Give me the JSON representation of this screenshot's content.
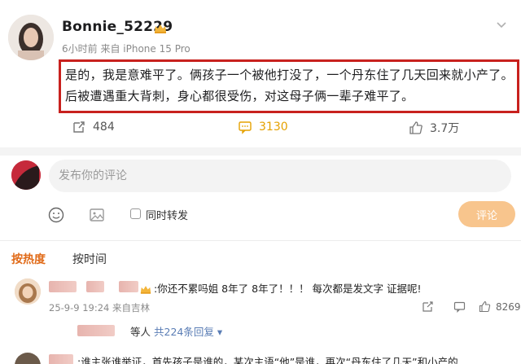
{
  "post": {
    "username": "Bonnie_52229",
    "time": "6小时前",
    "source": "来自 iPhone 15 Pro",
    "text_line1": "是的，我是意难平了。俩孩子一个被他打没了，一个丹东住了几天回来就小产了。",
    "text_line2": "后被遭遇重大背刺，身心都很受伤，对这母子俩一辈子难平了。",
    "reposts": "484",
    "comments": "3130",
    "likes": "3.7万"
  },
  "composer": {
    "placeholder": "发布你的评论",
    "repost_label": "同时转发",
    "submit_label": "评论"
  },
  "tabs": {
    "hot": "按热度",
    "time": "按时间"
  },
  "comments": [
    {
      "text": ":你还不累吗姐 8年了 8年了！！！ 每次都是发文字 证据呢!",
      "date": "25-9-9 19:24",
      "location": "来自吉林",
      "likes": "8269",
      "replies_suffix": "等人",
      "replies_link": "共224条回复"
    },
    {
      "text": ":谁主张谁举证，首先孩子是谁的，某次主语“他”是谁，再次“丹东住了几天”和小产的"
    }
  ],
  "colors": {
    "highlight_border": "#c8211e",
    "accent_orange": "#e06a18",
    "comment_count": "#e5a100",
    "submit_button": "#f8c58d",
    "link_blue": "#5a7db5"
  }
}
